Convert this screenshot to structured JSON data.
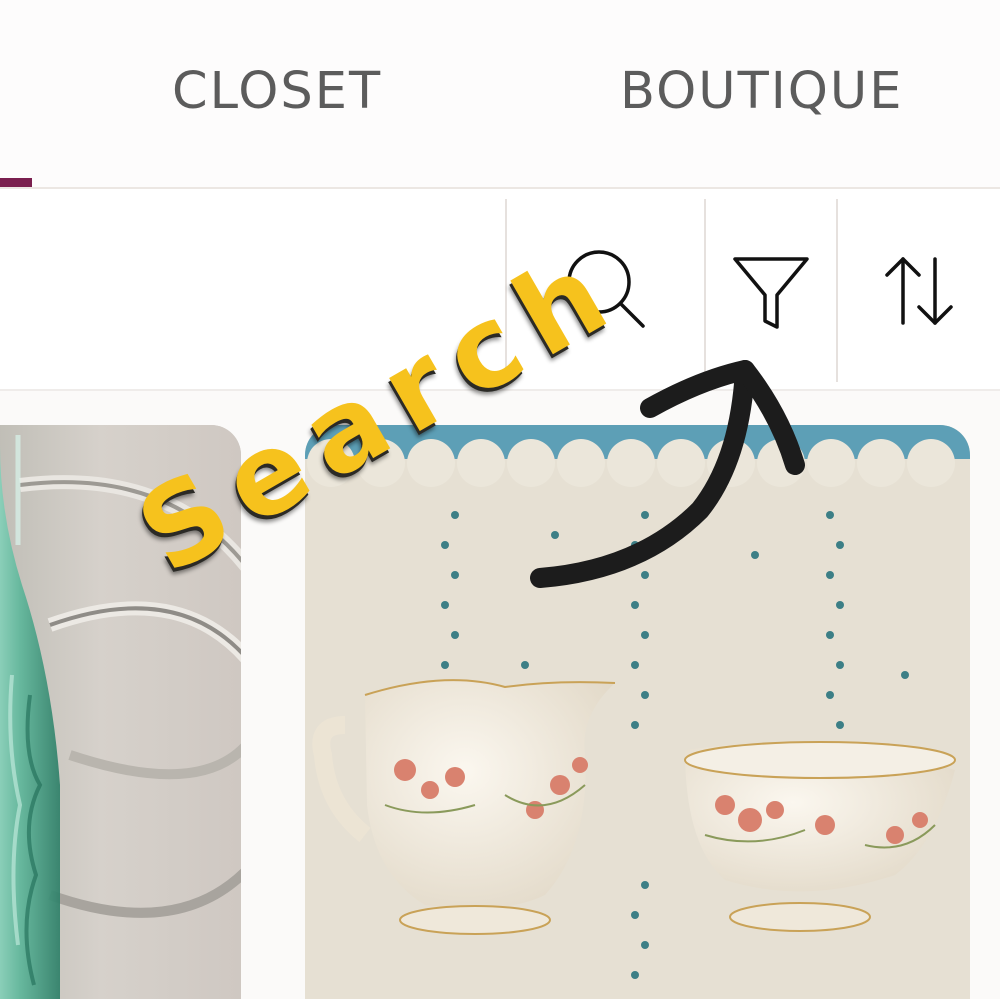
{
  "tabs": [
    {
      "label": "CLOSET",
      "active": false
    },
    {
      "label": "BOUTIQUE",
      "active": false
    }
  ],
  "toolbar": {
    "buttons": [
      {
        "icon": "search-icon"
      },
      {
        "icon": "filter-icon"
      },
      {
        "icon": "sort-icon"
      }
    ]
  },
  "annotation": {
    "text": "Search",
    "text_color": "#f6c21d",
    "arrow_color": "#1c1c1c"
  },
  "listings": [
    {
      "image": "green glass bottle"
    },
    {
      "image": "floral porcelain creamer and sugar bowl"
    }
  ],
  "colors": {
    "accent": "#7a1f4e",
    "tab_text": "#5c5c5c"
  }
}
